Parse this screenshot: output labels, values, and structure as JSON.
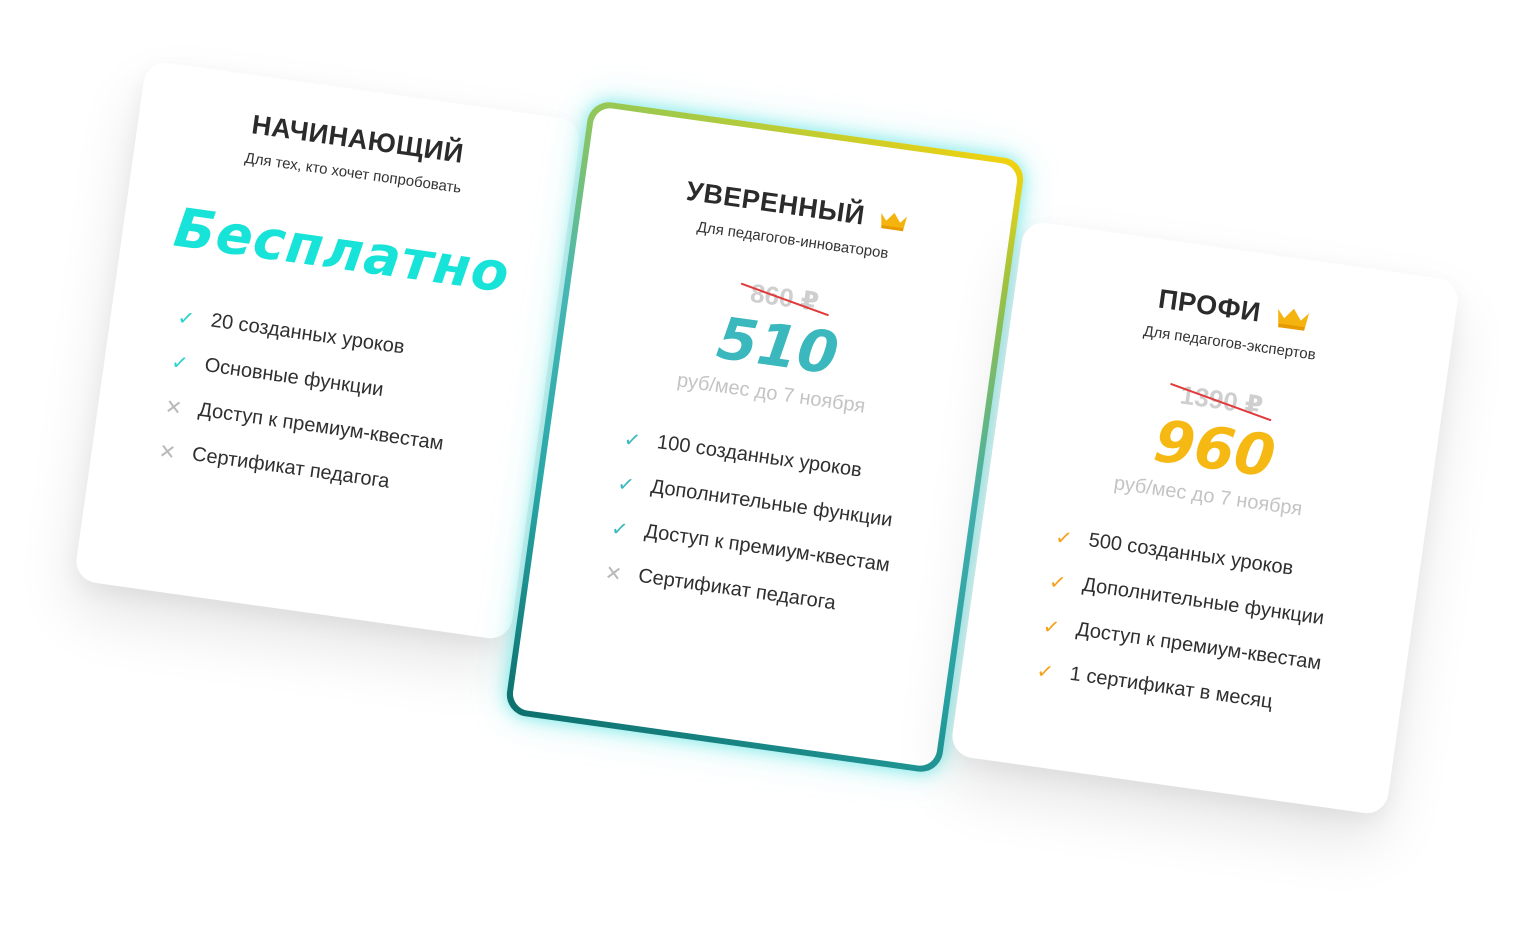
{
  "plans": [
    {
      "title": "НАЧИНАЮЩИЙ",
      "subtitle": "Для тех, кто хочет попробовать",
      "price_label": "Бесплатно",
      "accent_color": "#18e3d9",
      "features": [
        {
          "text": "20 созданных уроков",
          "included": true
        },
        {
          "text": "Основные функции",
          "included": true
        },
        {
          "text": "Доступ к премиум-квестам",
          "included": false
        },
        {
          "text": "Сертификат педагога",
          "included": false
        }
      ]
    },
    {
      "title": "УВЕРЕННЫЙ",
      "subtitle": "Для педагогов-инноваторов",
      "old_price": "860 ₽",
      "price": "510",
      "price_note": "руб/мес до 7 ноября",
      "accent_color": "#3ab8bd",
      "icon": "crown-icon",
      "featured": true,
      "features": [
        {
          "text": "100 созданных уроков",
          "included": true
        },
        {
          "text": "Дополнительные функции",
          "included": true
        },
        {
          "text": "Доступ к премиум-квестам",
          "included": true
        },
        {
          "text": "Сертификат педагога",
          "included": false
        }
      ]
    },
    {
      "title": "ПРОФИ",
      "subtitle": "Для педагогов-экспертов",
      "old_price": "1390 ₽",
      "price": "960",
      "price_note": "руб/мес до 7 ноября",
      "accent_color": "#f6b812",
      "icon": "crown-icon",
      "features": [
        {
          "text": "500 созданных уроков",
          "included": true
        },
        {
          "text": "Дополнительные функции",
          "included": true
        },
        {
          "text": "Доступ к премиум-квестам",
          "included": true
        },
        {
          "text": "1 сертификат в месяц",
          "included": true
        }
      ]
    }
  ],
  "colors": {
    "check_teal": "#2ad4cc",
    "check_orange": "#f6a01b",
    "cross_gray": "#b9b9b9",
    "strike_red": "#e13a3a",
    "crown_gold": "#f4b30f"
  }
}
